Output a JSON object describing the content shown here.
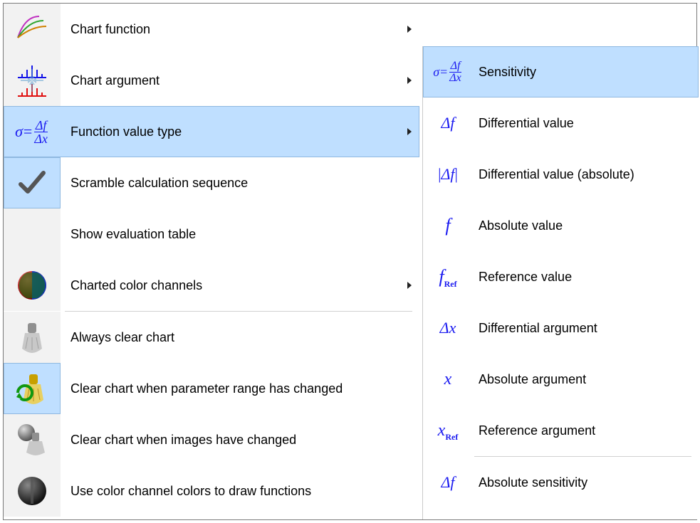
{
  "menu": {
    "items": [
      {
        "label": "Chart function",
        "has_submenu": true
      },
      {
        "label": "Chart argument",
        "has_submenu": true
      },
      {
        "label": "Function value type",
        "has_submenu": true,
        "highlight": true
      },
      {
        "label": "Scramble calculation sequence",
        "checked": true
      },
      {
        "label": "Show evaluation table"
      },
      {
        "label": "Charted color channels",
        "has_submenu": true
      },
      {
        "label": "Always clear chart"
      },
      {
        "label": "Clear chart when parameter range has changed",
        "selected": true
      },
      {
        "label": "Clear chart when images have changed"
      },
      {
        "label": "Use color channel colors to draw functions"
      }
    ]
  },
  "submenu": {
    "items": [
      {
        "label": "Sensitivity",
        "highlight": true
      },
      {
        "label": "Differential value"
      },
      {
        "label": "Differential value (absolute)"
      },
      {
        "label": "Absolute value"
      },
      {
        "label": "Reference value"
      },
      {
        "label": "Differential argument"
      },
      {
        "label": "Absolute argument"
      },
      {
        "label": "Reference argument"
      },
      {
        "label": "Absolute sensitivity"
      }
    ]
  }
}
